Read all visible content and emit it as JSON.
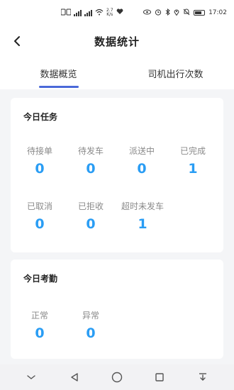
{
  "status_bar": {
    "speed_value": "2.7",
    "speed_unit": "K/s",
    "time": "17:02"
  },
  "header": {
    "title": "数据统计"
  },
  "tabs": [
    {
      "label": "数据概览",
      "active": true
    },
    {
      "label": "司机出行次数",
      "active": false
    }
  ],
  "today_tasks": {
    "title": "今日任务",
    "stats": [
      {
        "label": "待接单",
        "value": "0"
      },
      {
        "label": "待发车",
        "value": "0"
      },
      {
        "label": "派送中",
        "value": "0"
      },
      {
        "label": "已完成",
        "value": "1"
      },
      {
        "label": "已取消",
        "value": "0"
      },
      {
        "label": "已拒收",
        "value": "0"
      },
      {
        "label": "超时未发车",
        "value": "1"
      }
    ]
  },
  "today_attendance": {
    "title": "今日考勤",
    "stats": [
      {
        "label": "正常",
        "value": "0"
      },
      {
        "label": "异常",
        "value": "0"
      }
    ]
  },
  "colors": {
    "accent": "#2a9df4",
    "tab_indicator": "#4a69d9",
    "background": "#f4f5f7"
  }
}
